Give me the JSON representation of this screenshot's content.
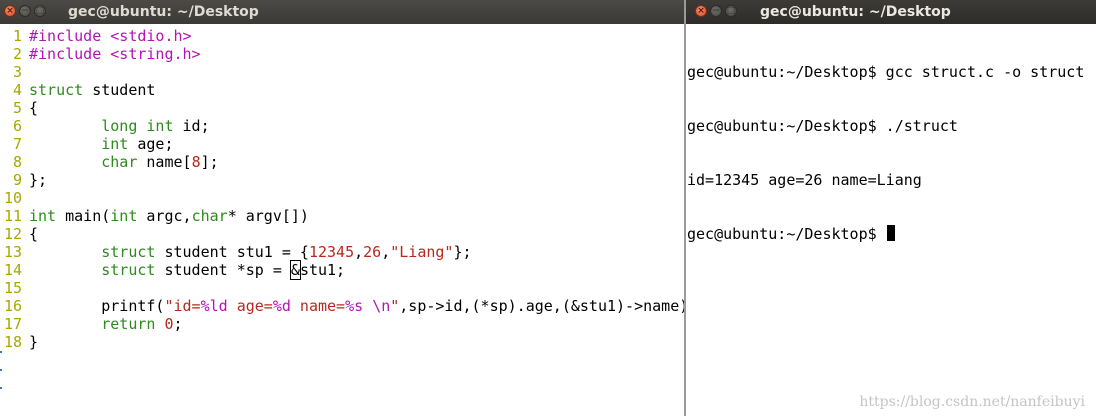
{
  "left_window": {
    "title": "gec@ubuntu: ~/Desktop",
    "buttons": {
      "close": "×",
      "minimize": "−",
      "maximize": "□"
    }
  },
  "editor": {
    "lines": [
      {
        "n": "1",
        "segs": [
          {
            "t": "#include <stdio.h>",
            "c": "pp"
          }
        ]
      },
      {
        "n": "2",
        "segs": [
          {
            "t": "#include <string.h>",
            "c": "pp"
          }
        ]
      },
      {
        "n": "3",
        "segs": []
      },
      {
        "n": "4",
        "segs": [
          {
            "t": "struct",
            "c": "ty"
          },
          {
            "t": " student"
          }
        ]
      },
      {
        "n": "5",
        "segs": [
          {
            "t": "{"
          }
        ]
      },
      {
        "n": "6",
        "segs": [
          {
            "t": "        "
          },
          {
            "t": "long",
            "c": "ty"
          },
          {
            "t": " "
          },
          {
            "t": "int",
            "c": "ty"
          },
          {
            "t": " id;"
          }
        ]
      },
      {
        "n": "7",
        "segs": [
          {
            "t": "        "
          },
          {
            "t": "int",
            "c": "ty"
          },
          {
            "t": " age;"
          }
        ]
      },
      {
        "n": "8",
        "segs": [
          {
            "t": "        "
          },
          {
            "t": "char",
            "c": "ty"
          },
          {
            "t": " name["
          },
          {
            "t": "8",
            "c": "nu"
          },
          {
            "t": "];"
          }
        ]
      },
      {
        "n": "9",
        "segs": [
          {
            "t": "};"
          }
        ]
      },
      {
        "n": "10",
        "segs": []
      },
      {
        "n": "11",
        "segs": [
          {
            "t": "int",
            "c": "ty"
          },
          {
            "t": " main("
          },
          {
            "t": "int",
            "c": "ty"
          },
          {
            "t": " argc,"
          },
          {
            "t": "char",
            "c": "ty"
          },
          {
            "t": "* argv[])"
          }
        ]
      },
      {
        "n": "12",
        "segs": [
          {
            "t": "{"
          }
        ]
      },
      {
        "n": "13",
        "segs": [
          {
            "t": "        "
          },
          {
            "t": "struct",
            "c": "ty"
          },
          {
            "t": " student stu1 = {"
          },
          {
            "t": "12345",
            "c": "nu"
          },
          {
            "t": ","
          },
          {
            "t": "26",
            "c": "nu"
          },
          {
            "t": ","
          },
          {
            "t": "\"Liang\"",
            "c": "st"
          },
          {
            "t": "};"
          }
        ]
      },
      {
        "n": "14",
        "segs": [
          {
            "t": "        "
          },
          {
            "t": "struct",
            "c": "ty"
          },
          {
            "t": " student *sp = "
          },
          {
            "t": "&",
            "c": "cursor-box"
          },
          {
            "t": "stu1;"
          }
        ]
      },
      {
        "n": "15",
        "segs": []
      },
      {
        "n": "16",
        "segs": [
          {
            "t": "        printf("
          },
          {
            "t": "\"id=",
            "c": "st"
          },
          {
            "t": "%ld",
            "c": "pp"
          },
          {
            "t": " age=",
            "c": "st"
          },
          {
            "t": "%d",
            "c": "pp"
          },
          {
            "t": " name=",
            "c": "st"
          },
          {
            "t": "%s",
            "c": "pp"
          },
          {
            "t": " ",
            "c": "st"
          },
          {
            "t": "\\n",
            "c": "pp"
          },
          {
            "t": "\"",
            "c": "st"
          },
          {
            "t": ",sp->id,(*sp).age,(&stu1)->name)"
          }
        ]
      },
      {
        "n": "17",
        "segs": [
          {
            "t": "        "
          },
          {
            "t": "return",
            "c": "ty"
          },
          {
            "t": " "
          },
          {
            "t": "0",
            "c": "nu"
          },
          {
            "t": ";"
          }
        ]
      },
      {
        "n": "18",
        "segs": [
          {
            "t": "}"
          }
        ]
      }
    ],
    "tilde_count": 3
  },
  "right_window": {
    "title": "gec@ubuntu: ~/Desktop",
    "buttons": {
      "close": "×",
      "minimize": "−",
      "maximize": "□"
    }
  },
  "terminal": {
    "lines": [
      "gec@ubuntu:~/Desktop$ gcc struct.c -o struct",
      "gec@ubuntu:~/Desktop$ ./struct",
      "id=12345 age=26 name=Liang",
      "gec@ubuntu:~/Desktop$ "
    ]
  },
  "watermark": "https://blog.csdn.net/nanfeibuyi"
}
